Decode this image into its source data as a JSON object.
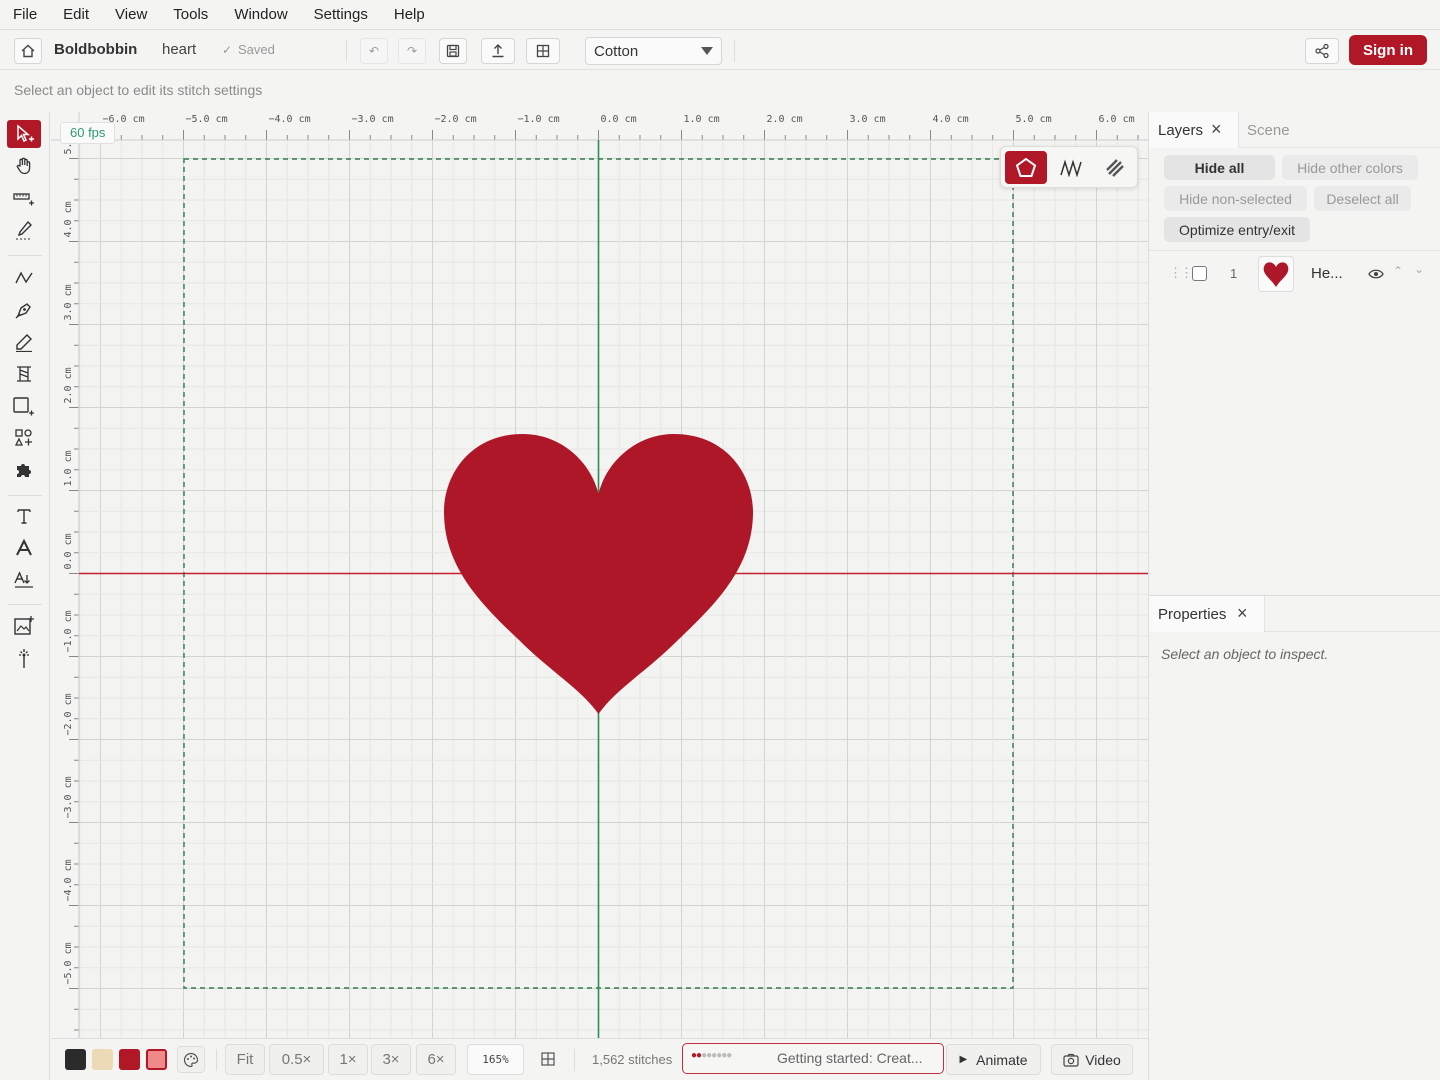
{
  "menu": [
    "File",
    "Edit",
    "View",
    "Tools",
    "Window",
    "Settings",
    "Help"
  ],
  "toolbar": {
    "app_name": "Boldbobbin",
    "file_name": "heart",
    "saved_label": "Saved",
    "fabric_value": "Cotton",
    "sign_in_label": "Sign in"
  },
  "hint_text": "Select an object to edit its stitch settings",
  "canvas": {
    "fps": "60 fps",
    "x_ticks": [
      "−6.0 cm",
      "−5.0 cm",
      "−4.0 cm",
      "−3.0 cm",
      "−2.0 cm",
      "−1.0 cm",
      "0.0 cm",
      "1.0 cm",
      "2.0 cm",
      "3.0 cm",
      "4.0 cm",
      "5.0 cm",
      "6.0 cm"
    ],
    "y_ticks": [
      "5.",
      "4.0 cm",
      "3.0 cm",
      "2.0 cm",
      "1.0 cm",
      "0.0 cm",
      "−1.0 cm",
      "−2.0 cm",
      "−3.0 cm",
      "−4.0 cm",
      "−5.0 cm"
    ]
  },
  "layers_panel": {
    "tab_layers": "Layers",
    "tab_scene": "Scene",
    "hide_all": "Hide all",
    "hide_other_colors": "Hide other colors",
    "hide_non_selected": "Hide non-selected",
    "deselect_all": "Deselect all",
    "optimize": "Optimize entry/exit",
    "layer": {
      "index": "1",
      "name": "He..."
    }
  },
  "properties_panel": {
    "title": "Properties",
    "empty_text": "Select an object to inspect."
  },
  "bottom": {
    "fit": "Fit",
    "zoom_options": [
      "0.5×",
      "1×",
      "3×",
      "6×"
    ],
    "zoom_value": "165%",
    "stitch_count": "1,562 stitches",
    "getting_started": "Getting started: Creat...",
    "animate": "Animate",
    "video": "Video"
  },
  "colors": {
    "accent": "#b01827",
    "swatches": [
      "#2b2b2b",
      "#ecd9b6",
      "#b01827",
      "#f08a8a"
    ]
  }
}
